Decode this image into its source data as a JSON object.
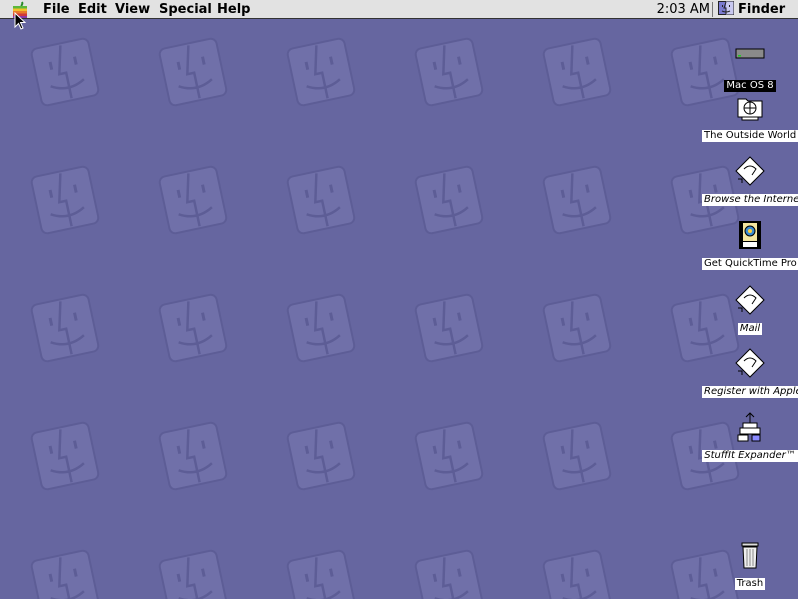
{
  "menubar": {
    "apple_icon": "apple-rainbow-icon",
    "items": [
      {
        "label": "File"
      },
      {
        "label": "Edit"
      },
      {
        "label": "View"
      },
      {
        "label": "Special"
      },
      {
        "label": "Help"
      }
    ],
    "clock": "2:03 AM",
    "app_menu": {
      "label": "Finder",
      "icon": "finder-icon"
    }
  },
  "desktop": {
    "background_color": "#6666a0",
    "pattern_icon": "finder-face-icon",
    "icons": [
      {
        "label": "Mac OS 8",
        "icon": "hard-drive-icon",
        "selected": true,
        "alias": false
      },
      {
        "label": "The Outside World",
        "icon": "network-folder-icon",
        "selected": false,
        "alias": false
      },
      {
        "label": "Browse the Internet",
        "icon": "alias-diamond-icon",
        "selected": false,
        "alias": true
      },
      {
        "label": "Get QuickTime Pro",
        "icon": "quicktime-movie-icon",
        "selected": false,
        "alias": false
      },
      {
        "label": "Mail",
        "icon": "alias-diamond-icon",
        "selected": false,
        "alias": true
      },
      {
        "label": "Register with Apple",
        "icon": "alias-diamond-icon",
        "selected": false,
        "alias": true
      },
      {
        "label": "StuffIt Expander™",
        "icon": "stuffit-expander-icon",
        "selected": false,
        "alias": true
      },
      {
        "label": "Trash",
        "icon": "trash-icon",
        "selected": false,
        "alias": false
      }
    ]
  }
}
